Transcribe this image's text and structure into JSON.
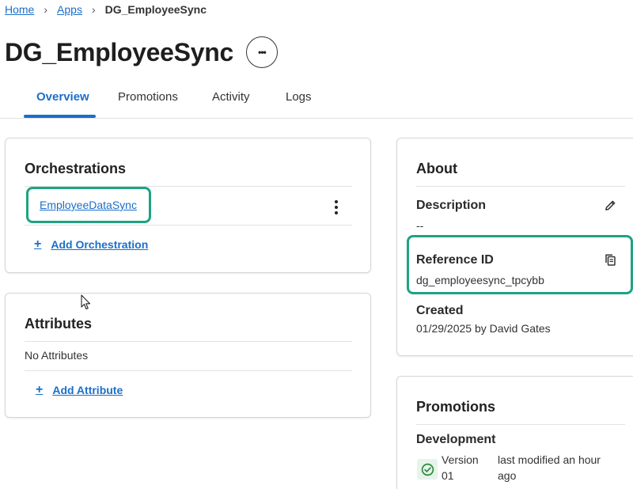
{
  "breadcrumb": {
    "home": "Home",
    "apps": "Apps",
    "current": "DG_EmployeeSync"
  },
  "page": {
    "title": "DG_EmployeeSync",
    "more_icon": "ellipsis-icon",
    "more_label": "•••"
  },
  "tabs": [
    {
      "label": "Overview",
      "active": true
    },
    {
      "label": "Promotions",
      "active": false
    },
    {
      "label": "Activity",
      "active": false
    },
    {
      "label": "Logs",
      "active": false
    }
  ],
  "orchestrations": {
    "title": "Orchestrations",
    "items": [
      {
        "name": "EmployeeDataSync"
      }
    ],
    "add_label": "Add Orchestration"
  },
  "attributes": {
    "title": "Attributes",
    "empty_text": "No Attributes",
    "add_label": "Add Attribute"
  },
  "about": {
    "title": "About",
    "description_label": "Description",
    "description_value": "--",
    "reference_label": "Reference ID",
    "reference_value": "dg_employeesync_tpcybb",
    "created_label": "Created",
    "created_value": "01/29/2025 by David Gates"
  },
  "promotions": {
    "title": "Promotions",
    "env_label": "Development",
    "version_line1": "Version",
    "version_line2": "01",
    "modified_line1": "last modified an hour",
    "modified_line2": "ago",
    "status_color": "#2e8b3d"
  },
  "colors": {
    "accent": "#1a6fc9",
    "highlight": "#1fa383"
  }
}
